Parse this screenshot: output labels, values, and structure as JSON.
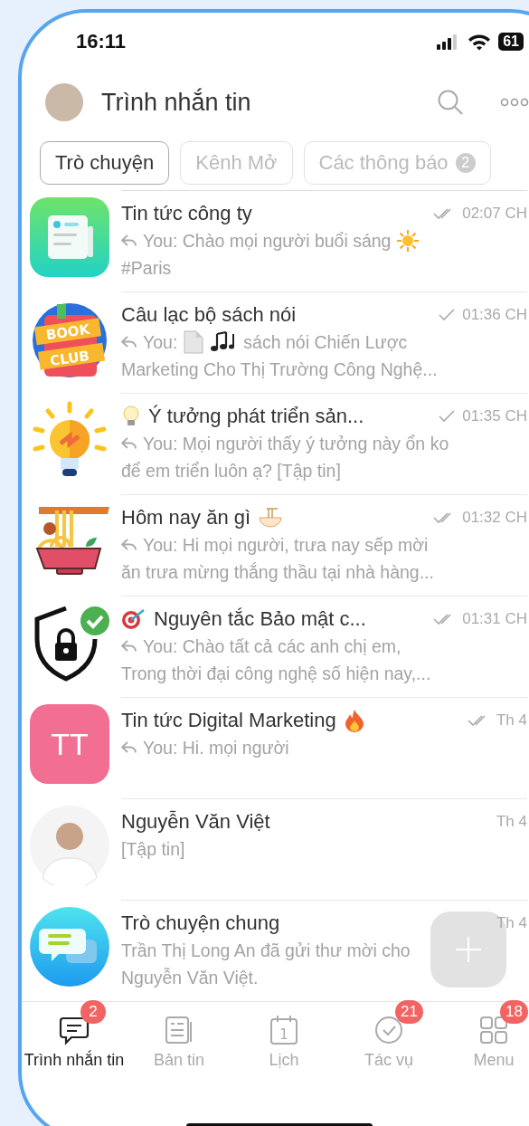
{
  "status_bar": {
    "time": "16:11",
    "battery": "61"
  },
  "header": {
    "title": "Trình nhắn tin"
  },
  "filters": [
    {
      "label": "Trò chuyện",
      "selected": true
    },
    {
      "label": "Kênh Mở",
      "selected": false
    },
    {
      "label": "Các thông báo",
      "selected": false,
      "badge": "2"
    }
  ],
  "chats": [
    {
      "avatar": {
        "kind": "newspaper"
      },
      "title": "Tin tức công ty",
      "ticks": {
        "kind": "double"
      },
      "time": "02:07 CH",
      "reply": true,
      "preview": [
        [
          {
            "kind": "text",
            "text": "You: Chào mọi người buổi sáng"
          },
          {
            "kind": "sun"
          }
        ],
        [
          {
            "kind": "text",
            "text": "#Paris"
          }
        ]
      ]
    },
    {
      "avatar": {
        "kind": "book-club",
        "lines": [
          "BOOK",
          "CLUB"
        ]
      },
      "title": "Câu lạc bộ sách nói",
      "ticks": {
        "kind": "single"
      },
      "time": "01:36 CH",
      "reply": true,
      "preview": [
        [
          {
            "kind": "text",
            "text": "You:"
          },
          {
            "kind": "document"
          },
          {
            "kind": "notes"
          },
          {
            "kind": "text",
            "text": "sách nói Chiến Lược"
          }
        ],
        [
          {
            "kind": "text",
            "text": "Marketing Cho Thị Trường Công Nghệ..."
          }
        ]
      ]
    },
    {
      "avatar": {
        "kind": "bulb"
      },
      "title_lead": {
        "kind": "bulb"
      },
      "title": "Ý tưởng phát triển sản...",
      "ticks": {
        "kind": "single"
      },
      "time": "01:35 CH",
      "reply": true,
      "preview": [
        [
          {
            "kind": "text",
            "text": "You: Mọi người thấy ý tưởng này ổn ko"
          }
        ],
        [
          {
            "kind": "text",
            "text": "để em triển luôn ạ? [Tập tin]"
          }
        ]
      ]
    },
    {
      "avatar": {
        "kind": "noodles"
      },
      "title": "Hôm nay ăn gì",
      "title_trail": {
        "kind": "bowl"
      },
      "ticks": {
        "kind": "double"
      },
      "time": "01:32 CH",
      "reply": true,
      "preview": [
        [
          {
            "kind": "text",
            "text": "You: Hi mọi người, trưa nay sếp mời"
          }
        ],
        [
          {
            "kind": "text",
            "text": "ăn trưa mừng thắng thầu tại nhà hàng..."
          }
        ]
      ]
    },
    {
      "avatar": {
        "kind": "shield"
      },
      "title_lead": {
        "kind": "target"
      },
      "title": "Nguyên tắc Bảo mật c...",
      "ticks": {
        "kind": "double"
      },
      "time": "01:31 CH",
      "reply": true,
      "preview": [
        [
          {
            "kind": "text",
            "text": "You: Chào tất cả các anh chị em,"
          }
        ],
        [
          {
            "kind": "text",
            "text": "Trong thời đại công nghệ số hiện nay,..."
          }
        ]
      ]
    },
    {
      "avatar": {
        "kind": "initials",
        "text": "TT",
        "color": "#f26f93"
      },
      "title": "Tin tức Digital Marketing",
      "title_trail": {
        "kind": "fire"
      },
      "ticks": {
        "kind": "double"
      },
      "time": "Th 4",
      "reply": true,
      "preview": [
        [
          {
            "kind": "text",
            "text": "You: Hi. mọi người"
          }
        ]
      ]
    },
    {
      "avatar": {
        "kind": "photo"
      },
      "title": "Nguyễn Văn Việt",
      "time": "Th 4",
      "reply": false,
      "preview": [
        [
          {
            "kind": "text",
            "text": "[Tập tin]"
          }
        ]
      ]
    },
    {
      "avatar": {
        "kind": "chat"
      },
      "title": "Trò chuyện chung",
      "time": "Th 4",
      "reply": false,
      "preview": [
        [
          {
            "kind": "text",
            "text": "Trần Thị Long An đã gửi thư mời cho"
          }
        ],
        [
          {
            "kind": "text",
            "text": "Nguyễn Văn Việt."
          }
        ]
      ]
    }
  ],
  "nav": [
    {
      "kind": "chat",
      "label": "Trình nhắn tin",
      "selected": true,
      "badge": "2"
    },
    {
      "kind": "news",
      "label": "Bản tin",
      "selected": false
    },
    {
      "kind": "calendar",
      "label": "Lịch",
      "selected": false,
      "day": "1"
    },
    {
      "kind": "tasks",
      "label": "Tác vụ",
      "selected": false,
      "badge": "21"
    },
    {
      "kind": "menu",
      "label": "Menu",
      "selected": false,
      "badge": "18"
    }
  ]
}
